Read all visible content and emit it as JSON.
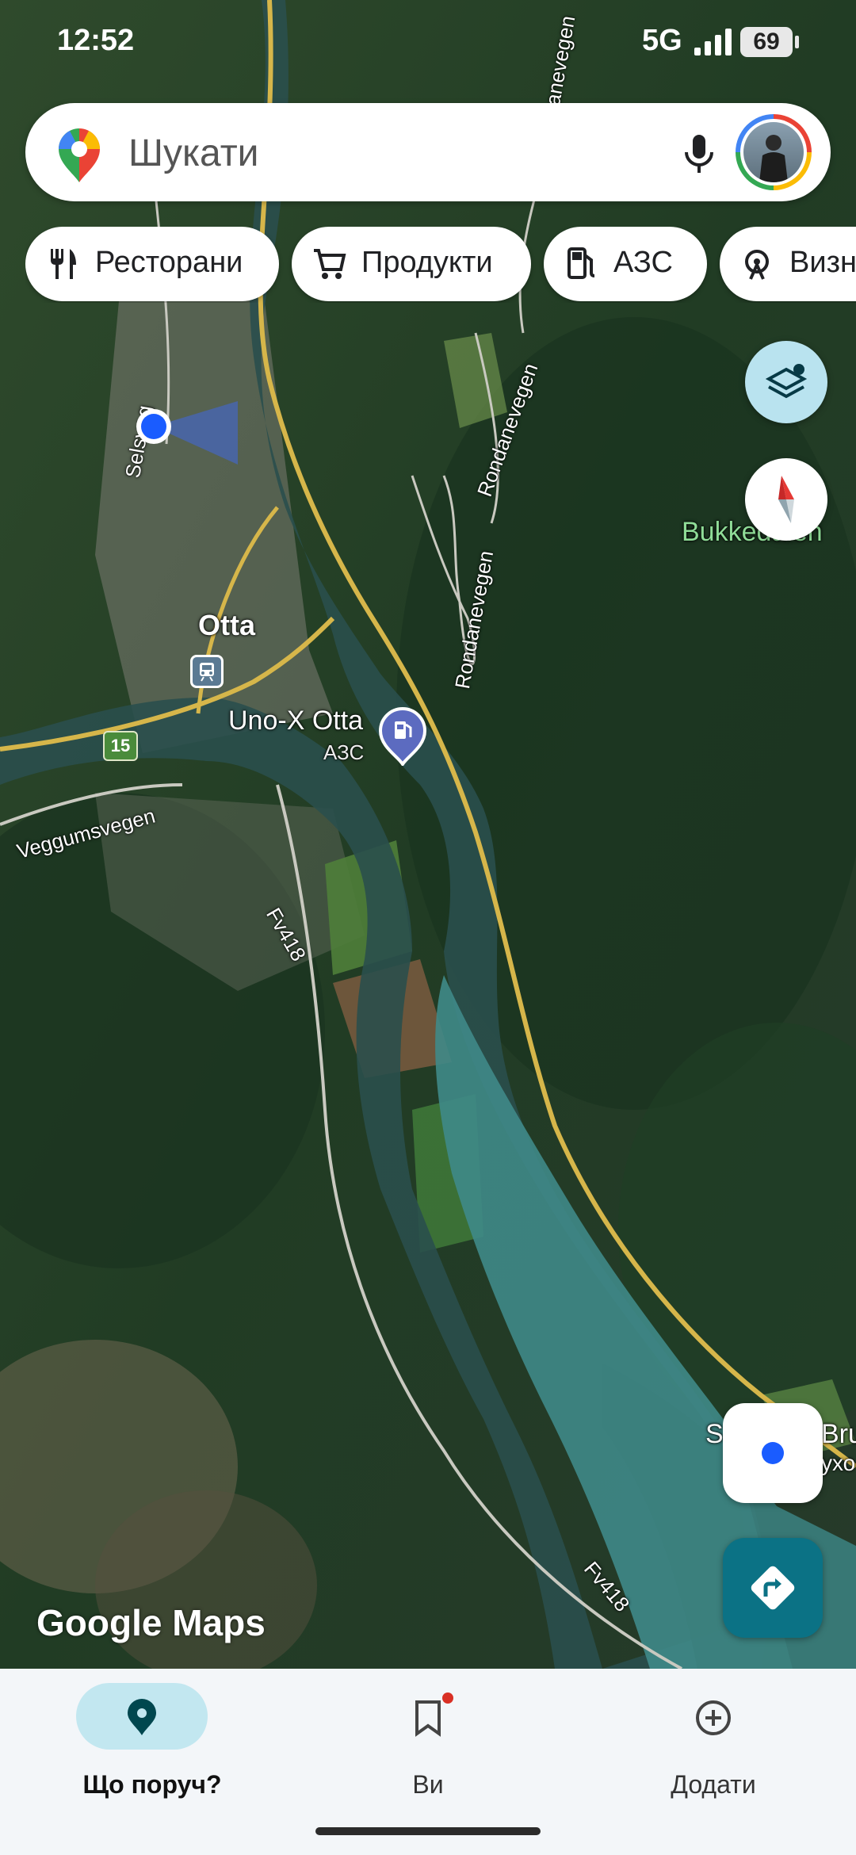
{
  "status_bar": {
    "time": "12:52",
    "network": "5G",
    "battery": "69"
  },
  "search": {
    "placeholder": "Шукати"
  },
  "chips": [
    {
      "label": "Ресторани",
      "icon": "fork-knife-icon"
    },
    {
      "label": "Продукти",
      "icon": "cart-icon"
    },
    {
      "label": "АЗС",
      "icon": "fuel-pump-icon"
    },
    {
      "label": "Визн",
      "icon": "attraction-icon"
    }
  ],
  "map": {
    "labels": {
      "town": "Otta",
      "station_name": "Uno-X Otta",
      "station_type": "АЗС",
      "road_selsvegen": "Selsveg",
      "road_rondanevegen_1": "Rondanevegen",
      "road_rondanevegen_2": "Rondanevegen",
      "road_rondanevegen_3": "Rondanevegen",
      "road_anevegen": "anevegen",
      "road_veggumsvegen": "Veggumsvegen",
      "road_fv418_1": "Fv418",
      "road_fv418_2": "Fv418",
      "route_badge": "15",
      "place_bukkedalen": "Bukkedalen",
      "place_s_bru": "S",
      "place_bru": "Bru",
      "place_suxo": "ухо"
    },
    "attribution": "Google Maps"
  },
  "bottom_nav": [
    {
      "label": "Що поруч?",
      "icon": "explore-pin-icon",
      "active": true
    },
    {
      "label": "Ви",
      "icon": "bookmark-icon",
      "active": false
    },
    {
      "label": "Додати",
      "icon": "add-circle-icon",
      "active": false
    }
  ],
  "colors": {
    "accent": "#0b7285",
    "active_pill": "#c2e7f0",
    "location_dot": "#1a5cff",
    "label_green": "#7ed68a"
  }
}
